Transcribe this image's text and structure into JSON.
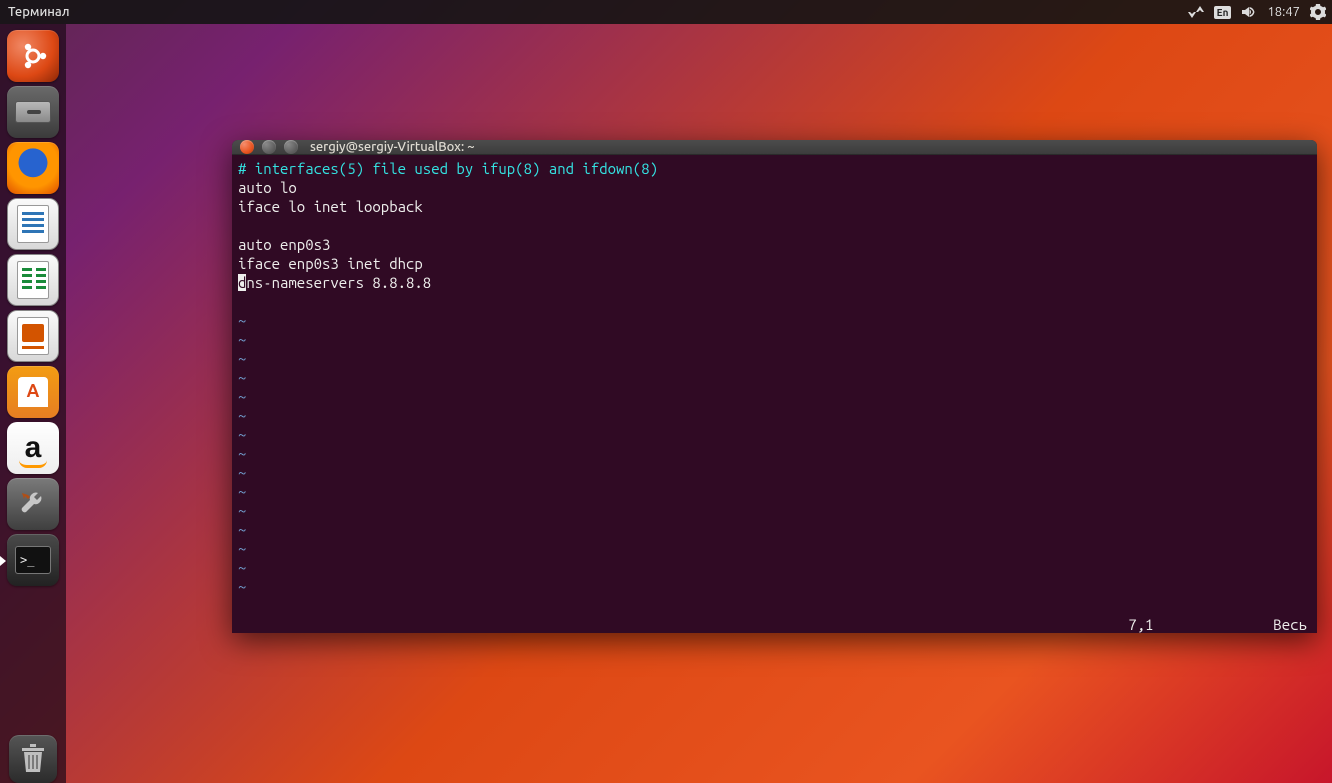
{
  "topbar": {
    "app_title": "Терминал",
    "language": "En",
    "time": "18:47"
  },
  "launcher": {
    "ubuntu": "ubuntu-dash",
    "files": "files",
    "firefox": "firefox",
    "writer": "libreoffice-writer",
    "calc": "libreoffice-calc",
    "impress": "libreoffice-impress",
    "software": "ubuntu-software",
    "amazon": "amazon",
    "settings": "system-settings",
    "terminal": "terminal",
    "trash": "trash"
  },
  "terminal": {
    "title": "sergiy@sergiy-VirtualBox: ~",
    "prompt_symbol": ">_",
    "lines": {
      "comment": "# interfaces(5) file used by ifup(8) and ifdown(8)",
      "l1": "auto lo",
      "l2": "iface lo inet loopback",
      "l3": "",
      "l4": "auto enp0s3",
      "l5": "iface enp0s3 inet dhcp",
      "l6_cursor": "d",
      "l6_rest": "ns-nameservers 8.8.8.8"
    },
    "tilde": "~",
    "status": {
      "pos": "7,1",
      "scroll": "Весь"
    }
  }
}
